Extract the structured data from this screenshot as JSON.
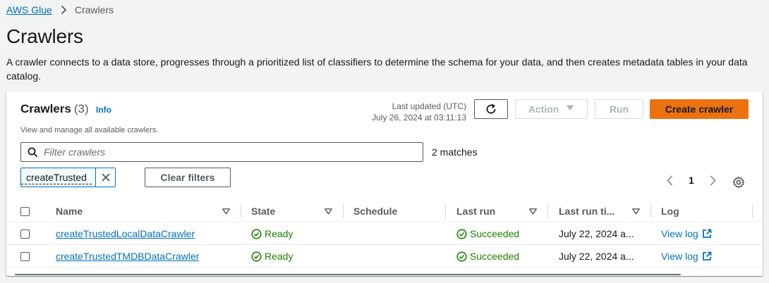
{
  "breadcrumb": {
    "root": "AWS Glue",
    "current": "Crawlers"
  },
  "page": {
    "title": "Crawlers",
    "description": "A crawler connects to a data store, progresses through a prioritized list of classifiers to determine the schema for your data, and then creates metadata tables in your data catalog."
  },
  "panel": {
    "title": "Crawlers",
    "count": "(3)",
    "info": "Info",
    "subtitle": "View and manage all available crawlers.",
    "last_updated_label": "Last updated (UTC)",
    "last_updated_value": "July 26, 2024 at 03:11:13",
    "action_label": "Action",
    "run_label": "Run",
    "create_label": "Create crawler"
  },
  "filter": {
    "placeholder": "Filter crawlers",
    "matches": "2 matches",
    "token": "createTrusted",
    "clear_label": "Clear filters"
  },
  "pagination": {
    "current_page": "1"
  },
  "table": {
    "columns": [
      "Name",
      "State",
      "Schedule",
      "Last run",
      "Last run ti...",
      "Log"
    ],
    "rows": [
      {
        "name": "createTrustedLocalDataCrawler",
        "state": "Ready",
        "schedule": "",
        "last_run": "Succeeded",
        "last_run_time": "July 22, 2024 a...",
        "log": "View log"
      },
      {
        "name": "createTrustedTMDBDataCrawler",
        "state": "Ready",
        "schedule": "",
        "last_run": "Succeeded",
        "last_run_time": "July 22, 2024 a...",
        "log": "View log"
      }
    ]
  },
  "colors": {
    "link": "#0073bb",
    "primary_button": "#ec7211",
    "success": "#1d8102",
    "background": "#f2f3f3"
  },
  "icons": {
    "breadcrumb_separator": "chevron-right-icon",
    "refresh": "refresh-icon",
    "action_caret": "caret-down-icon",
    "search": "search-icon",
    "token_close": "close-icon",
    "pager_prev": "chevron-left-icon",
    "pager_next": "chevron-right-icon",
    "settings": "gear-icon",
    "sort": "caret-down-icon",
    "status": "check-circle-icon",
    "external_link": "external-link-icon"
  }
}
